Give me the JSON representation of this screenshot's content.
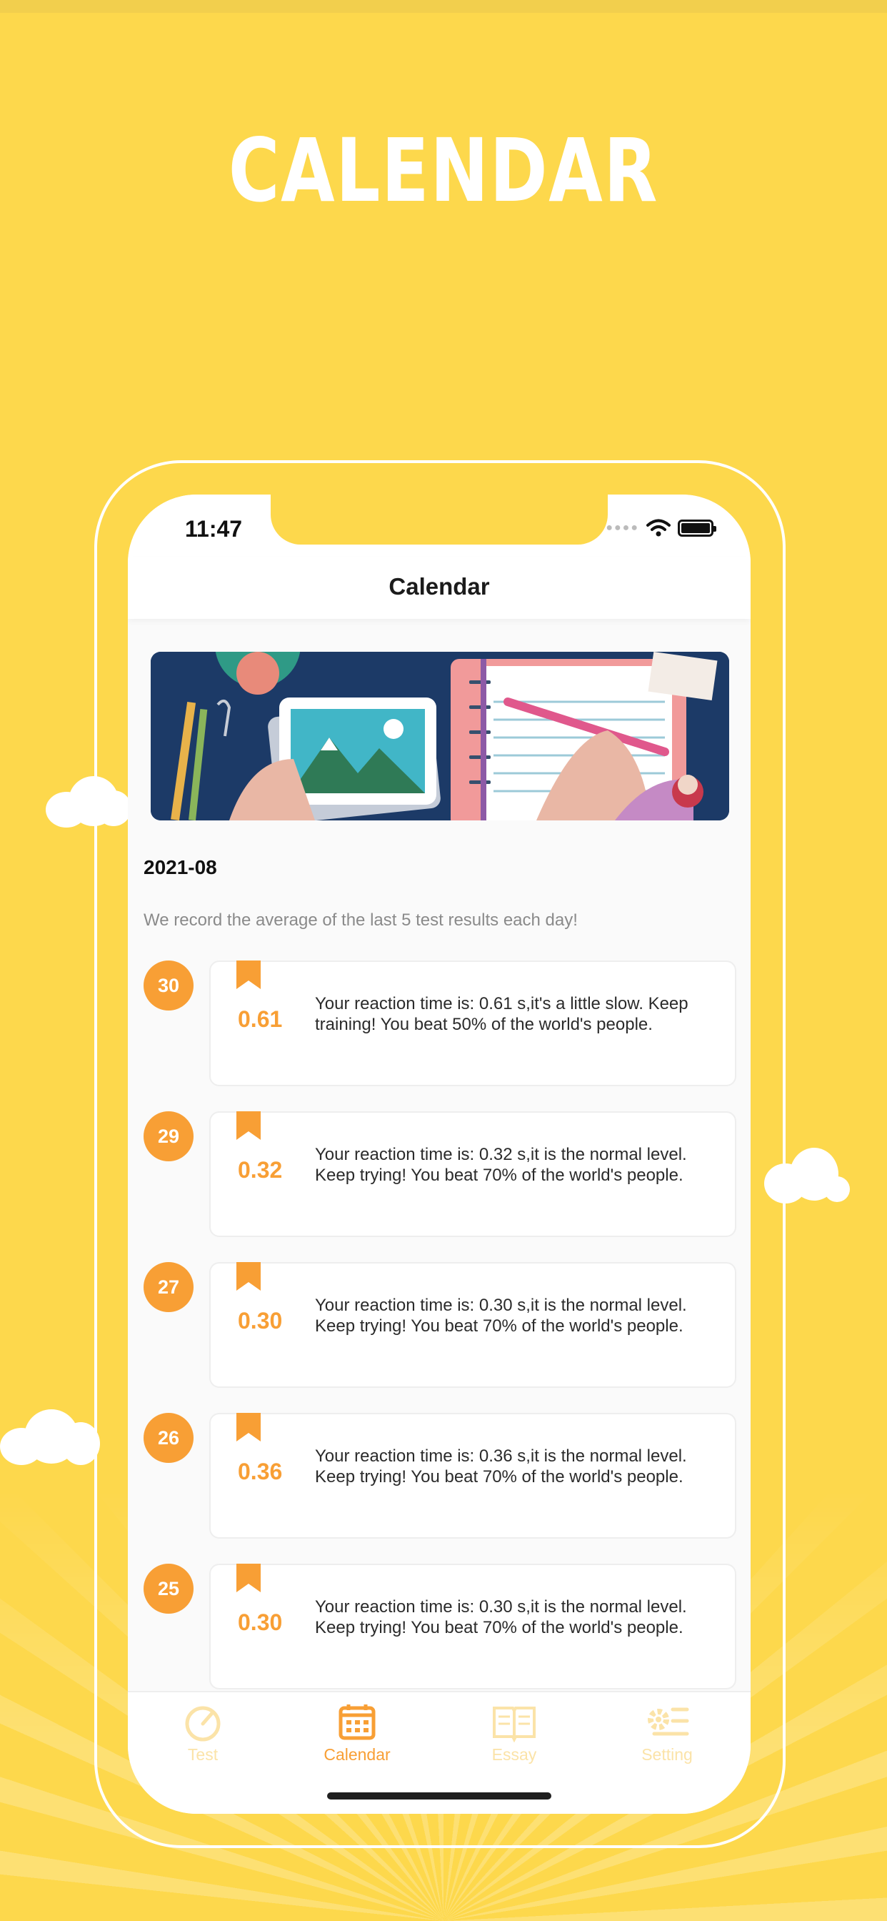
{
  "promo": {
    "headline": "CALENDAR"
  },
  "status_bar": {
    "time": "11:47"
  },
  "nav": {
    "title": "Calendar"
  },
  "month": "2021-08",
  "notice": "We record the average of the last 5 test results each day!",
  "entries": [
    {
      "day": "30",
      "score": "0.61",
      "message": "Your reaction time is: 0.61 s,it's a little slow. Keep training! You beat 50% of the world's people."
    },
    {
      "day": "29",
      "score": "0.32",
      "message": "Your reaction time is: 0.32 s,it is the normal level. Keep trying! You beat 70% of the world's people."
    },
    {
      "day": "27",
      "score": "0.30",
      "message": "Your reaction time is: 0.30 s,it is the normal level. Keep trying! You beat 70% of the world's people."
    },
    {
      "day": "26",
      "score": "0.36",
      "message": "Your reaction time is: 0.36 s,it is the normal level. Keep trying! You beat 70% of the world's people."
    },
    {
      "day": "25",
      "score": "0.30",
      "message": "Your reaction time is: 0.30 s,it is the normal level. Keep trying! You beat 70% of the world's people."
    }
  ],
  "tabs": [
    {
      "label": "Test",
      "icon": "speedometer-icon",
      "active": false
    },
    {
      "label": "Calendar",
      "icon": "calendar-icon",
      "active": true
    },
    {
      "label": "Essay",
      "icon": "book-icon",
      "active": false
    },
    {
      "label": "Setting",
      "icon": "gear-icon",
      "active": false
    }
  ],
  "colors": {
    "background": "#fdd84c",
    "accent": "#f89f35",
    "inactive_tab": "#fbe3a8"
  }
}
